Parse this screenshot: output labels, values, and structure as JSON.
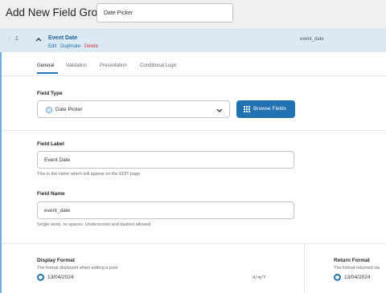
{
  "header": {
    "title": "Add New Field Group",
    "group_title_value": "Date Picker"
  },
  "field": {
    "order": "1",
    "label": "Event Date",
    "name": "event_date",
    "actions": {
      "edit": "Edit",
      "duplicate": "Duplicate",
      "delete": "Delete"
    }
  },
  "tabs": [
    {
      "label": "General",
      "active": true
    },
    {
      "label": "Validation",
      "active": false
    },
    {
      "label": "Presentation",
      "active": false
    },
    {
      "label": "Conditional Logic",
      "active": false
    }
  ],
  "field_type": {
    "label": "Field Type",
    "value": "Date Picker",
    "browse_button": "Browse Fields"
  },
  "field_label": {
    "label": "Field Label",
    "value": "Event Date",
    "help": "This is the name which will appear on the EDIT page"
  },
  "field_name": {
    "label": "Field Name",
    "value": "event_date",
    "help": "Single word, no spaces. Underscores and dashes allowed"
  },
  "display_format": {
    "label": "Display Format",
    "help": "The format displayed when editing a post",
    "selected_option": "13/04/2024",
    "code": "d/m/Y"
  },
  "return_format": {
    "label": "Return Format",
    "help": "The format returned via",
    "selected_option": "13/04/2024"
  },
  "colors": {
    "accent": "#2271b1",
    "row_highlight": "#dbe9f5",
    "delete": "#d63638"
  }
}
